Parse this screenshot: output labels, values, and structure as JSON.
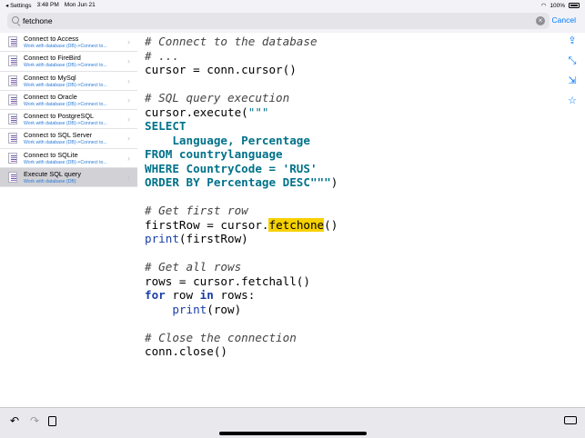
{
  "statusbar": {
    "back": "◂ Settings",
    "time": "3:48 PM",
    "date": "Mon Jun 21",
    "battery": "100%"
  },
  "search": {
    "value": "fetchone",
    "cancel": "Cancel"
  },
  "sidebar": {
    "items": [
      {
        "title": "Connect to Access",
        "subtitle": "Work with database (DB)->Connect to..."
      },
      {
        "title": "Connect to FireBird",
        "subtitle": "Work with database (DB)->Connect to..."
      },
      {
        "title": "Connect to MySql",
        "subtitle": "Work with database (DB)->Connect to..."
      },
      {
        "title": "Connect to Oracle",
        "subtitle": "Work with database (DB)->Connect to..."
      },
      {
        "title": "Connect to PostgreSQL",
        "subtitle": "Work with database (DB)->Connect to..."
      },
      {
        "title": "Connect to SQL Server",
        "subtitle": "Work with database (DB)->Connect to..."
      },
      {
        "title": "Connect to SQLite",
        "subtitle": "Work with database (DB)->Connect to..."
      },
      {
        "title": "Execute SQL query",
        "subtitle": "Work with database (DB)"
      }
    ]
  },
  "code": {
    "l1": "# Connect to the database",
    "l2": "# ...",
    "l3": "cursor = conn.cursor()",
    "l5": "# SQL query execution",
    "l6a": "cursor.execute(",
    "l6b": "\"\"\"",
    "l7": "SELECT",
    "l8": "    Language, Percentage",
    "l9": "FROM countrylanguage",
    "l10": "WHERE CountryCode = 'RUS'",
    "l11": "ORDER BY Percentage DESC\"\"\"",
    "l11b": ")",
    "l13": "# Get first row",
    "l14a": "firstRow = cursor.",
    "l14b": "fetchone",
    "l14c": "()",
    "l15a": "print",
    "l15b": "(firstRow)",
    "l17": "# Get all rows",
    "l18": "rows = cursor.fetchall()",
    "l19a": "for",
    "l19b": " row ",
    "l19c": "in",
    "l19d": " rows:",
    "l20a": "    ",
    "l20b": "print",
    "l20c": "(row)",
    "l22": "# Close the connection",
    "l23": "conn.close()"
  }
}
